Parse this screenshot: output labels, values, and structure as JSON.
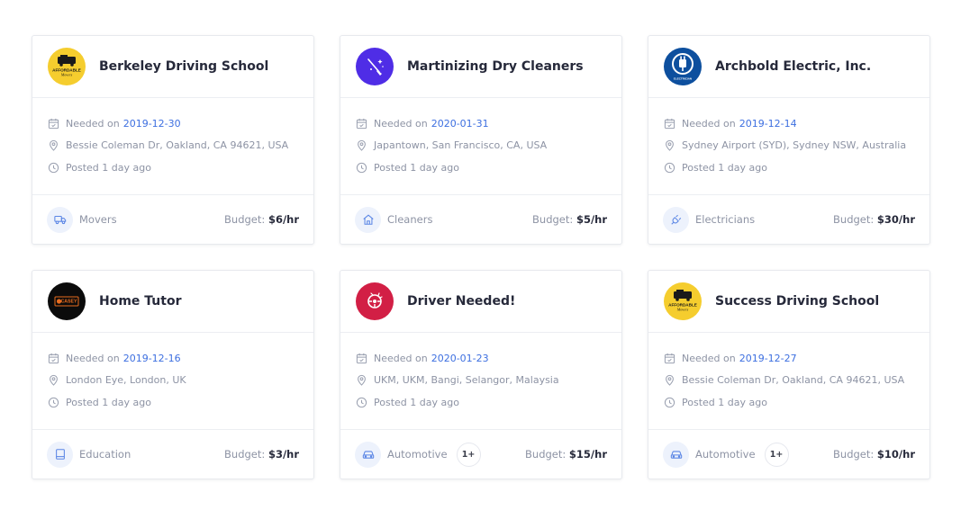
{
  "jobs": [
    {
      "title": "Berkeley Driving School",
      "logo": {
        "icon": "affordable-movers-logo",
        "bg": "#f5cd2e",
        "text_top": "AFFORDABLE",
        "text_bottom": "Movers"
      },
      "needed_label": "Needed on",
      "needed_date": "2019-12-30",
      "location": "Bessie Coleman Dr, Oakland, CA 94621, USA",
      "posted": "Posted 1 day ago",
      "category": {
        "label": "Movers",
        "icon": "truck-icon"
      },
      "budget_label": "Budget:",
      "budget_value": "$6/hr"
    },
    {
      "title": "Martinizing Dry Cleaners",
      "logo": {
        "icon": "broom-sparkle-logo",
        "bg": "#4f2de6"
      },
      "needed_label": "Needed on",
      "needed_date": "2020-01-31",
      "location": "Japantown, San Francisco, CA, USA",
      "posted": "Posted 1 day ago",
      "category": {
        "label": "Cleaners",
        "icon": "home-icon"
      },
      "budget_label": "Budget:",
      "budget_value": "$5/hr"
    },
    {
      "title": "Archbold Electric, Inc.",
      "logo": {
        "icon": "electric-plug-logo",
        "bg": "#0d4f9e",
        "text_bottom": "ELECTRICIAN"
      },
      "needed_label": "Needed on",
      "needed_date": "2019-12-14",
      "location": "Sydney Airport (SYD), Sydney NSW, Australia",
      "posted": "Posted 1 day ago",
      "category": {
        "label": "Electricians",
        "icon": "plug-icon"
      },
      "budget_label": "Budget:",
      "budget_value": "$30/hr"
    },
    {
      "title": "Home Tutor",
      "logo": {
        "icon": "casey-logo",
        "bg": "#0b0b0b",
        "text_top": "CASEY"
      },
      "needed_label": "Needed on",
      "needed_date": "2019-12-16",
      "location": "London Eye, London, UK",
      "posted": "Posted 1 day ago",
      "category": {
        "label": "Education",
        "icon": "book-icon"
      },
      "budget_label": "Budget:",
      "budget_value": "$3/hr"
    },
    {
      "title": "Driver Needed!",
      "logo": {
        "icon": "driver-logo",
        "bg": "#d21f45"
      },
      "needed_label": "Needed on",
      "needed_date": "2020-01-23",
      "location": "UKM, UKM, Bangi, Selangor, Malaysia",
      "posted": "Posted 1 day ago",
      "category": {
        "label": "Automotive",
        "icon": "car-icon"
      },
      "more": "1+",
      "budget_label": "Budget:",
      "budget_value": "$15/hr"
    },
    {
      "title": "Success Driving School",
      "logo": {
        "icon": "affordable-movers-logo",
        "bg": "#f5cd2e",
        "text_top": "AFFORDABLE",
        "text_bottom": "Movers"
      },
      "needed_label": "Needed on",
      "needed_date": "2019-12-27",
      "location": "Bessie Coleman Dr, Oakland, CA 94621, USA",
      "posted": "Posted 1 day ago",
      "category": {
        "label": "Automotive",
        "icon": "car-icon"
      },
      "more": "1+",
      "budget_label": "Budget:",
      "budget_value": "$10/hr"
    }
  ],
  "colors": {
    "accent": "#3d6fe0",
    "muted": "#8d93a4",
    "heading": "#26293a",
    "icon": "#5b86e5"
  }
}
